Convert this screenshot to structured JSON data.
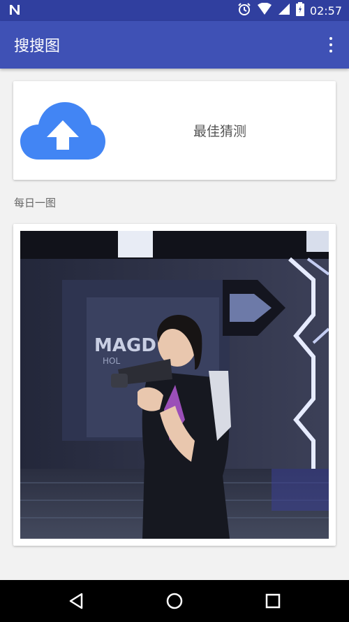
{
  "status_bar": {
    "time": "02:57",
    "icons": [
      "notification-n-icon",
      "alarm-icon",
      "wifi-icon",
      "signal-icon",
      "battery-icon"
    ]
  },
  "app_bar": {
    "title": "搜搜图",
    "overflow_icon": "more-vert-icon"
  },
  "upload_card": {
    "icon": "cloud-upload-icon",
    "label": "最佳猜测"
  },
  "daily": {
    "label": "每日一图",
    "image": "daily-photo"
  },
  "nav_bar": {
    "icons": [
      "back-icon",
      "home-icon",
      "recents-icon"
    ]
  },
  "colors": {
    "status_bar": "#303f9f",
    "app_bar": "#3f51b5",
    "cloud": "#4285f4",
    "background": "#f2f2f2"
  }
}
